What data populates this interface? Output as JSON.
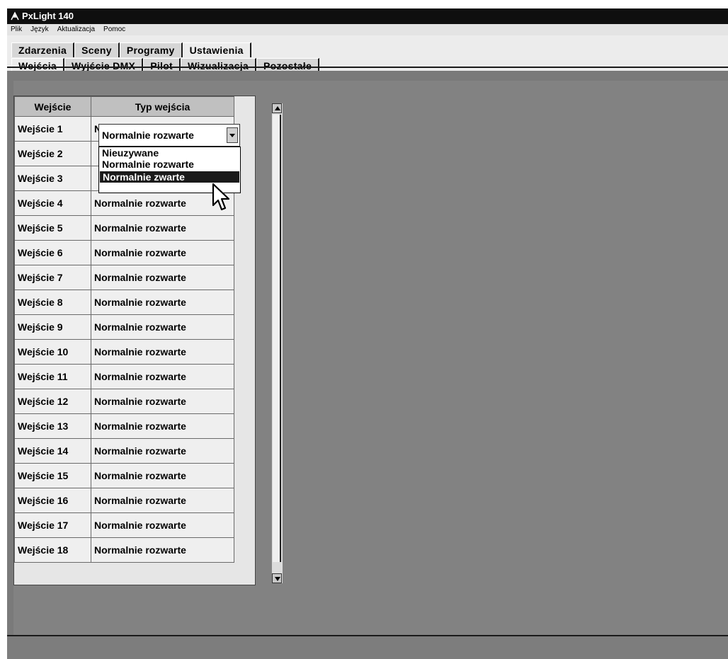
{
  "window": {
    "title": "PxLight 140"
  },
  "menu": [
    "Plik",
    "Język",
    "Aktualizacja",
    "Pomoc"
  ],
  "main_tabs": [
    "Zdarzenia",
    "Sceny",
    "Programy",
    "Ustawienia"
  ],
  "main_tab_active": "Ustawienia",
  "sub_tabs": [
    "Wejścia",
    "Wyjście DMX",
    "Pilot",
    "Wizualizacja",
    "Pozostałe"
  ],
  "sub_tab_active": "Wejścia",
  "grid": {
    "columns": [
      "Wejście",
      "Typ wejścia"
    ],
    "rows": [
      [
        "Wejście 1",
        "Normalnie rozwarte"
      ],
      [
        "Wejście 2",
        ""
      ],
      [
        "Wejście 3",
        ""
      ],
      [
        "Wejście 4",
        "Normalnie rozwarte"
      ],
      [
        "Wejście 5",
        "Normalnie rozwarte"
      ],
      [
        "Wejście 6",
        "Normalnie rozwarte"
      ],
      [
        "Wejście 7",
        "Normalnie rozwarte"
      ],
      [
        "Wejście 8",
        "Normalnie rozwarte"
      ],
      [
        "Wejście 9",
        "Normalnie rozwarte"
      ],
      [
        "Wejście 10",
        "Normalnie rozwarte"
      ],
      [
        "Wejście 11",
        "Normalnie rozwarte"
      ],
      [
        "Wejście 12",
        "Normalnie rozwarte"
      ],
      [
        "Wejście 13",
        "Normalnie rozwarte"
      ],
      [
        "Wejście 14",
        "Normalnie rozwarte"
      ],
      [
        "Wejście 15",
        "Normalnie rozwarte"
      ],
      [
        "Wejście 16",
        "Normalnie rozwarte"
      ],
      [
        "Wejście 17",
        "Normalnie rozwarte"
      ],
      [
        "Wejście 18",
        "Normalnie rozwarte"
      ]
    ]
  },
  "dropdown": {
    "current_value": "Normalnie rozwarte",
    "options": [
      "Nieuzywane",
      "Normalnie rozwarte",
      "Normalnie zwarte"
    ],
    "highlighted": "Normalnie zwarte"
  },
  "colors": {
    "titlebar": "#0f0f0f",
    "workspace": "#7a7a7a",
    "selection": "#1a1a1a"
  }
}
